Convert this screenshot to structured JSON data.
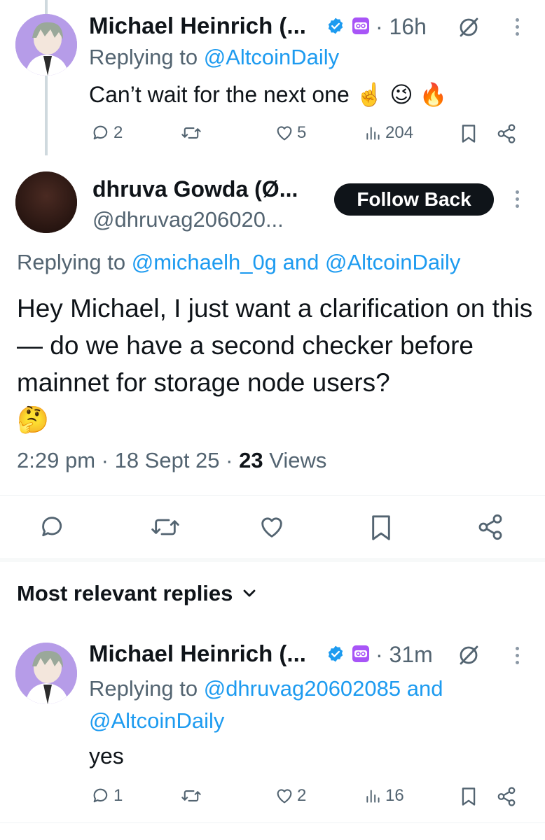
{
  "reply_top": {
    "name": "Michael Heinrich (...",
    "time": "16h",
    "replying_prefix": "Replying to",
    "replying_to": "@AltcoinDaily",
    "text": "Can’t wait for the next one",
    "emojis": "☝️ 😉 🔥",
    "stats": {
      "replies": "2",
      "likes": "5",
      "views": "204"
    }
  },
  "main_tweet": {
    "name": "dhruva Gowda (Ø...",
    "handle": "@dhruvag206020...",
    "follow_label": "Follow Back",
    "replying_prefix": "Replying to",
    "replying_to_1": "@michaelh_0g",
    "replying_and": "and",
    "replying_to_2": "@AltcoinDaily",
    "text": "Hey Michael, I just want a clarification on this — do we have a second checker before mainnet for storage node users?",
    "emoji": "🤔",
    "time": "2:29 pm",
    "date": "18 Sept 25",
    "views_count": "23",
    "views_label": "Views"
  },
  "replies_section": {
    "title": "Most relevant replies"
  },
  "reply_bottom": {
    "name": "Michael Heinrich (...",
    "time": "31m",
    "replying_prefix": "Replying to",
    "replying_to_1": "@dhruvag20602085",
    "replying_and": "and",
    "replying_to_2": "@AltcoinDaily",
    "text": "yes",
    "stats": {
      "replies": "1",
      "likes": "2",
      "views": "16"
    }
  },
  "colors": {
    "link": "#1d9bf0",
    "muted": "#536471",
    "verified": "#1d9bf0",
    "affiliate_badge": "#a855f7"
  },
  "icons": [
    "verified-badge-icon",
    "affiliate-badge-icon",
    "grok-icon",
    "more-icon",
    "reply-icon",
    "retweet-icon",
    "like-icon",
    "views-icon",
    "bookmark-icon",
    "share-icon",
    "chevron-down-icon"
  ]
}
